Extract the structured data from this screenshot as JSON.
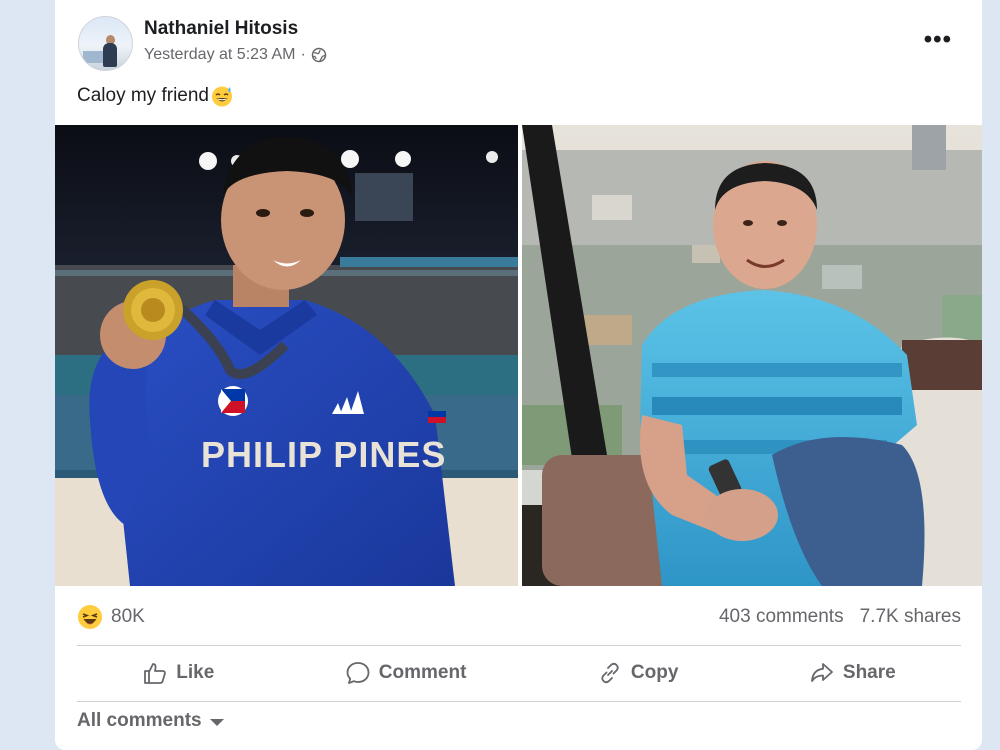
{
  "post": {
    "author": "Nathaniel Hitosis",
    "timestamp": "Yesterday at 5:23 AM",
    "separator": "·",
    "visibility_icon": "globe-icon",
    "more_icon": "more-horizontal-icon",
    "more_label": "•••",
    "caption": "Caloy my friend",
    "caption_emoji": "grinning-sweat-emoji"
  },
  "photos": {
    "left": {
      "jacket_text": "PHILIP PINES"
    }
  },
  "stats": {
    "reaction_icon": "haha-reaction-icon",
    "reactions": "80K",
    "comments": "403 comments",
    "shares": "7.7K shares"
  },
  "actions": [
    {
      "label": "Like",
      "icon": "thumbs-up-icon"
    },
    {
      "label": "Comment",
      "icon": "comment-icon"
    },
    {
      "label": "Copy",
      "icon": "link-icon"
    },
    {
      "label": "Share",
      "icon": "share-icon"
    }
  ],
  "comments_filter": {
    "label": "All comments",
    "icon": "caret-down-icon"
  },
  "colors": {
    "background": "#dde6f3",
    "card": "#ffffff",
    "secondary_text": "#65676b",
    "jacket_blue": "#1f3fae",
    "shirt_blue": "#48b6de"
  }
}
